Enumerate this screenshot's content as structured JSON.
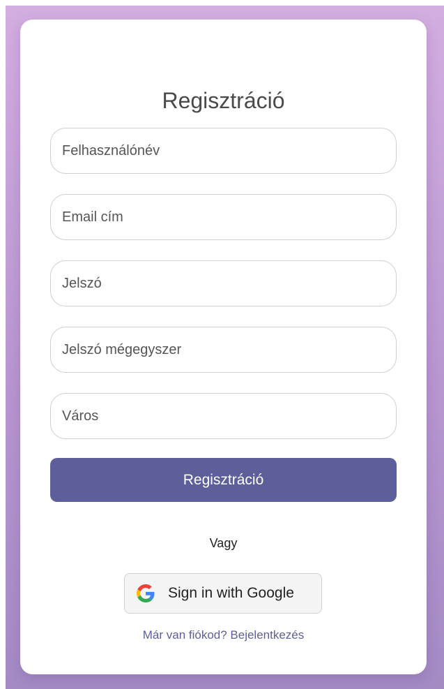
{
  "form": {
    "title": "Regisztráció",
    "fields": [
      {
        "name": "username",
        "placeholder": "Felhasználónév",
        "value": ""
      },
      {
        "name": "email",
        "placeholder": "Email cím",
        "value": ""
      },
      {
        "name": "password",
        "placeholder": "Jelszó",
        "value": ""
      },
      {
        "name": "password_confirm",
        "placeholder": "Jelszó mégegyszer",
        "value": ""
      },
      {
        "name": "city",
        "placeholder": "Város",
        "value": ""
      }
    ],
    "submit_label": "Regisztráció",
    "divider_text": "Vagy",
    "google_label": "Sign in with Google",
    "google_icon": "google-g-icon",
    "login_link_text": "Már van fiókod? Bejelentkezés"
  },
  "colors": {
    "background_top": "#d2aee0",
    "background_bottom": "#a48bc4",
    "button": "#5c5f9a",
    "link": "#5c5f9a"
  }
}
